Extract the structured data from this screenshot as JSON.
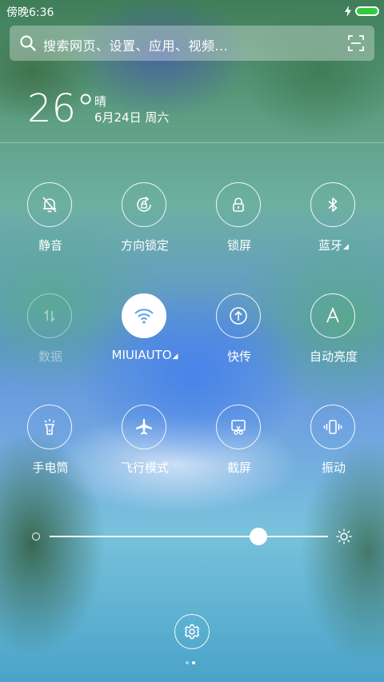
{
  "status_bar": {
    "time": "傍晚6:36",
    "icons": [
      "charging-bolt-icon",
      "battery-icon"
    ],
    "battery_color": "#2ecc3a"
  },
  "search": {
    "placeholder": "搜索网页、设置、应用、视频...",
    "icons": [
      "search-icon",
      "scan-icon"
    ]
  },
  "weather": {
    "temperature": "26°",
    "condition": "晴",
    "date": "6月24日 周六"
  },
  "toggles": [
    {
      "label": "静音",
      "icon": "mute-bell-icon",
      "state": "off"
    },
    {
      "label": "方向锁定",
      "icon": "rotation-lock-icon",
      "state": "off"
    },
    {
      "label": "锁屏",
      "icon": "lock-icon",
      "state": "off"
    },
    {
      "label": "蓝牙",
      "icon": "bluetooth-icon",
      "state": "off",
      "expandable": true
    },
    {
      "label": "数据",
      "icon": "mobile-data-icon",
      "state": "disabled"
    },
    {
      "label": "MIUIAUTO",
      "icon": "wifi-icon",
      "state": "on",
      "expandable": true
    },
    {
      "label": "快传",
      "icon": "quick-transfer-icon",
      "state": "off"
    },
    {
      "label": "自动亮度",
      "icon": "auto-brightness-icon",
      "state": "off"
    },
    {
      "label": "手电筒",
      "icon": "flashlight-icon",
      "state": "off"
    },
    {
      "label": "飞行模式",
      "icon": "airplane-icon",
      "state": "off"
    },
    {
      "label": "截屏",
      "icon": "screenshot-icon",
      "state": "off"
    },
    {
      "label": "振动",
      "icon": "vibrate-icon",
      "state": "off"
    }
  ],
  "brightness": {
    "level": 0.75,
    "icons": [
      "brightness-low-icon",
      "brightness-high-icon"
    ]
  },
  "bottom": {
    "settings_icon": "gear-icon",
    "page_count": 2,
    "active_page": 2
  }
}
